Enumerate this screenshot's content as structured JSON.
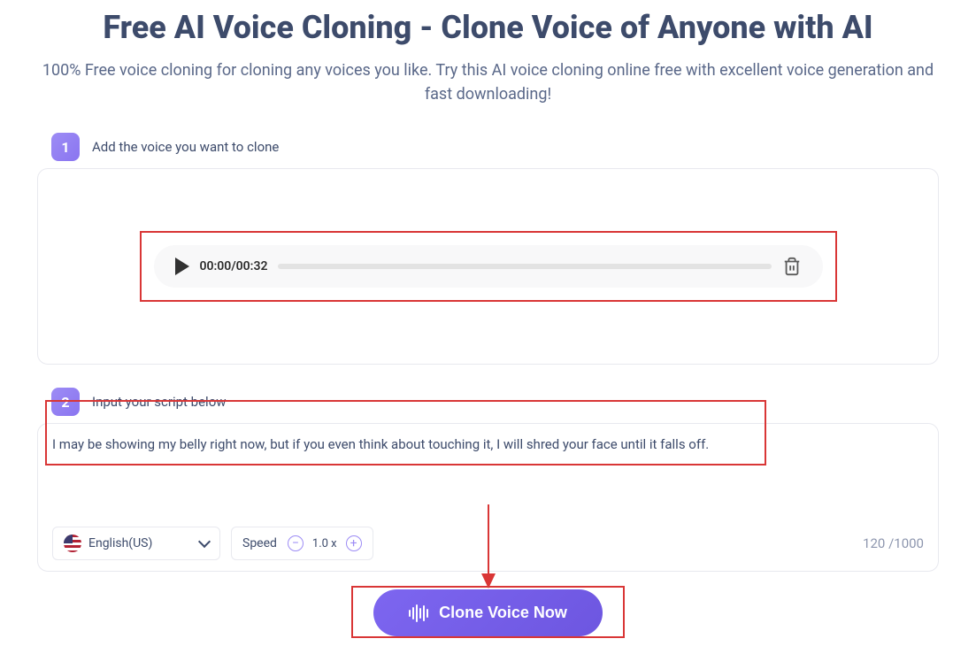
{
  "header": {
    "title": "Free AI Voice Cloning - Clone Voice of Anyone with AI",
    "subtitle": "100% Free voice cloning for cloning any voices you like. Try this AI voice cloning online free with excellent voice generation and fast downloading!"
  },
  "step1": {
    "number": "1",
    "label": "Add the voice you want to clone",
    "audio": {
      "current_time": "00:00",
      "duration": "00:32"
    }
  },
  "step2": {
    "number": "2",
    "label": "Input your script below",
    "script_text": "I may be showing my belly right now, but if you even think about touching it, I will shred your face until it falls off.",
    "language": "English(US)",
    "speed_label": "Speed",
    "speed_value": "1.0 x",
    "char_count": "120",
    "char_max": "1000"
  },
  "cta": {
    "label": "Clone Voice Now"
  }
}
